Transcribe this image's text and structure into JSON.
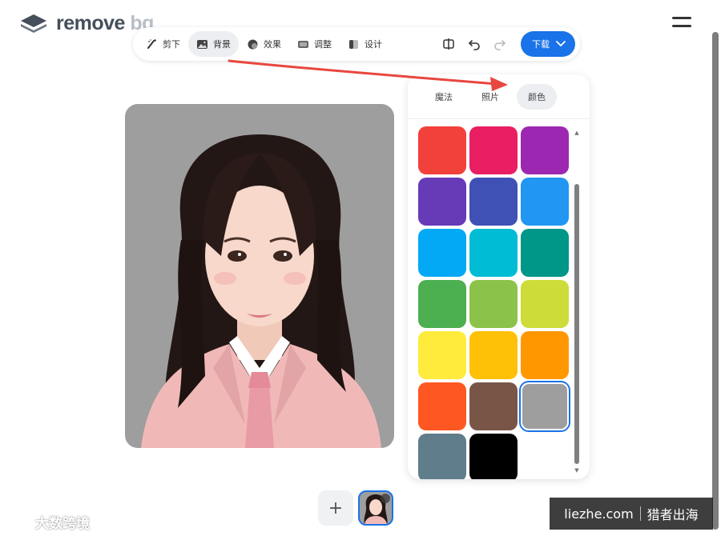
{
  "brand": {
    "remove": "remove",
    "bg": "bg"
  },
  "toolbar": {
    "tools": [
      {
        "label": "剪下",
        "icon": "brush-icon"
      },
      {
        "label": "背景",
        "icon": "image-icon"
      },
      {
        "label": "效果",
        "icon": "circle-effect-icon"
      },
      {
        "label": "调整",
        "icon": "adjust-icon"
      },
      {
        "label": "设计",
        "icon": "design-icon"
      }
    ],
    "active_tool": "背景",
    "compare_icon": "compare-icon",
    "undo_icon": "undo-icon",
    "redo_icon": "redo-icon",
    "download_label": "下载"
  },
  "panel": {
    "tabs": [
      "魔法",
      "照片",
      "颜色"
    ],
    "active_tab": "颜色",
    "swatches": [
      "#f2403a",
      "#e91e63",
      "#9c27b0",
      "#673ab7",
      "#3f51b5",
      "#2196f3",
      "#03a9f4",
      "#00bcd4",
      "#009688",
      "#4caf50",
      "#8bc34a",
      "#cddc39",
      "#ffeb3b",
      "#ffc107",
      "#ff9800",
      "#ff5722",
      "#795548",
      "#9e9e9e",
      "#607d8b",
      "#000000"
    ],
    "selected_swatch": "#9e9e9e"
  },
  "canvas": {
    "background_color": "#9e9e9e"
  },
  "bottom": {
    "add_label": "+"
  },
  "watermarks": {
    "left_brand": "大数跨境",
    "right_site": "liezhe.com",
    "right_brand": "猎者出海"
  },
  "colors": {
    "accent": "#1a73e8",
    "annotation_arrow": "#e8473f"
  }
}
